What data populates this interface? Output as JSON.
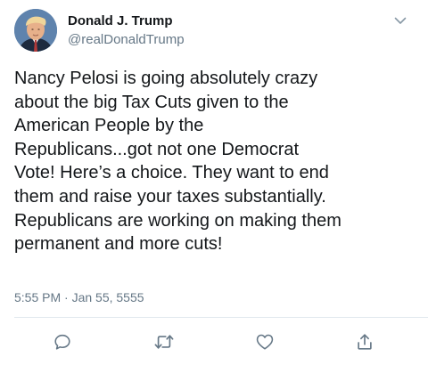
{
  "author": {
    "display_name": "Donald J. Trump",
    "handle": "@realDonaldTrump"
  },
  "tweet": {
    "text": "Nancy Pelosi is going absolutely crazy\nabout the big Tax Cuts given to the\nAmerican People by the\nRepublicans...got not one Democrat\nVote! Here’s a choice. They want to end\nthem and raise your taxes substantially.\nRepublicans are working on making them\npermanent and more cuts!",
    "timestamp": "5:55 PM · Jan 55, 5555"
  },
  "icons": {
    "more": "chevron-down-icon",
    "reply": "reply-icon",
    "retweet": "retweet-icon",
    "like": "heart-icon",
    "share": "share-icon"
  },
  "colors": {
    "text": "#14171a",
    "secondary": "#657786",
    "divider": "#e1e8ed"
  }
}
